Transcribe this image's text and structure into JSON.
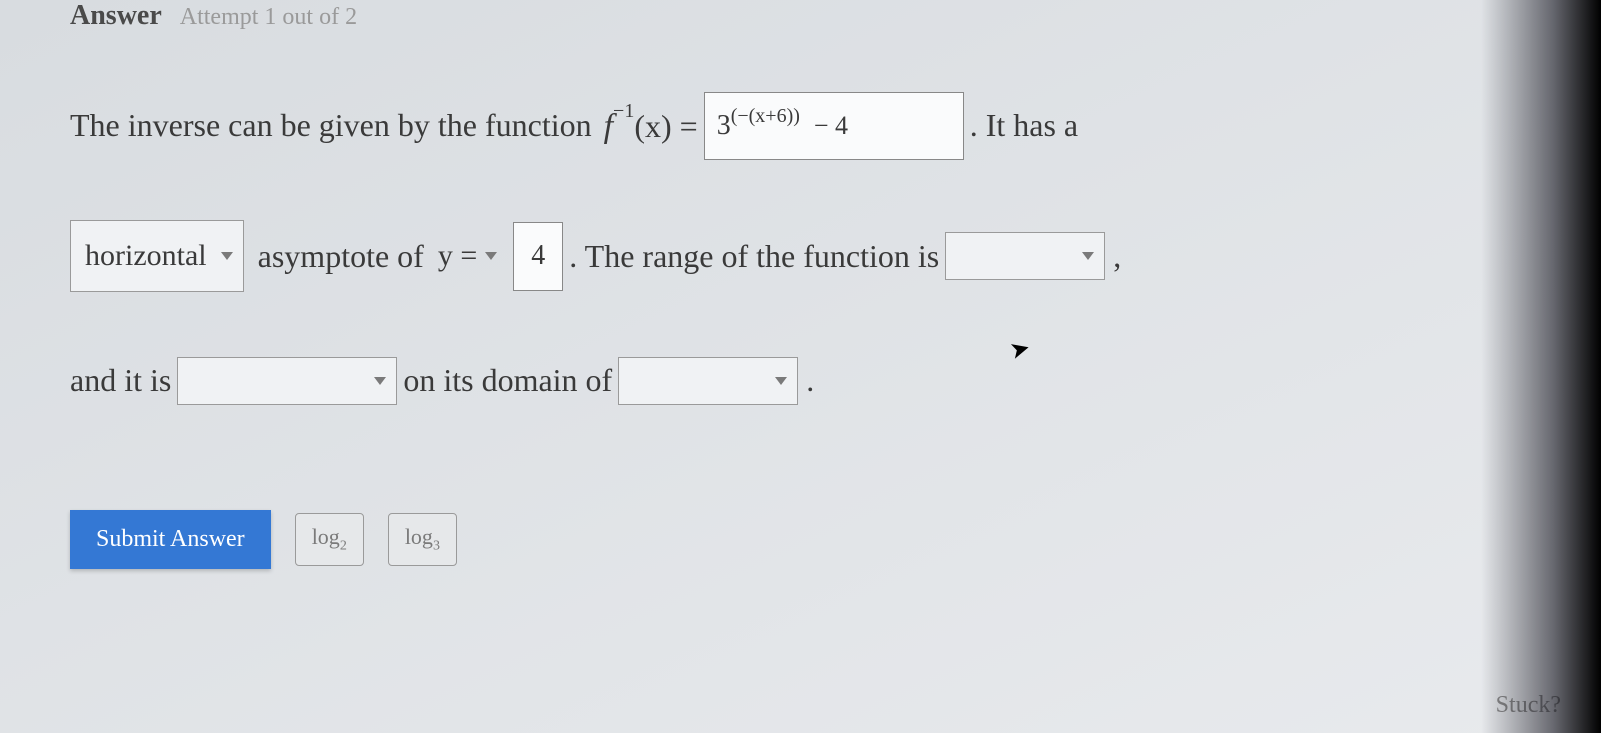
{
  "header": {
    "answer_label": "Answer",
    "attempt_text": "Attempt 1 out of 2"
  },
  "line1": {
    "prefix": "The inverse can be given by the function",
    "func_label": "f",
    "func_sup": "−1",
    "func_arg": "(x) =",
    "input_base": "3",
    "input_exp": "(−(x+6))",
    "input_tail": "− 4",
    "suffix": ". It has a"
  },
  "line2": {
    "dropdown_asymptote": "horizontal",
    "text_asymptote": "asymptote of",
    "var_label": "y =",
    "input_value": "4",
    "range_text": ". The range of the function is",
    "comma": ","
  },
  "line3": {
    "prefix": "and it is",
    "mid_text": "on its domain of",
    "period": "."
  },
  "buttons": {
    "submit": "Submit Answer",
    "log2": "log",
    "log2_sub": "2",
    "log3": "log",
    "log3_sub": "3"
  },
  "footer": {
    "stuck": "Stuck?"
  }
}
